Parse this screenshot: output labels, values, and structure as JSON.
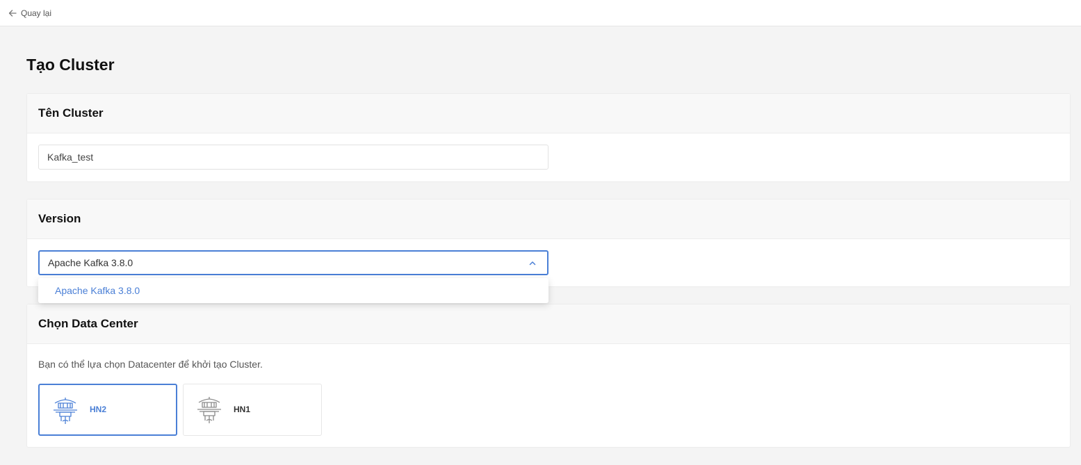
{
  "topbar": {
    "back_label": "Quay lại",
    "back_icon": "arrow-left-icon"
  },
  "page": {
    "title": "Tạo Cluster"
  },
  "cluster_name": {
    "heading": "Tên Cluster",
    "value": "Kafka_test"
  },
  "version": {
    "heading": "Version",
    "selected": "Apache Kafka 3.8.0",
    "toggle_icon": "chevron-up-icon",
    "options": [
      "Apache Kafka 3.8.0"
    ]
  },
  "datacenter": {
    "heading": "Chọn Data Center",
    "description": "Bạn có thể lựa chọn Datacenter để khởi tạo Cluster.",
    "options": [
      {
        "label": "HN2",
        "icon": "pagoda-icon",
        "selected": true
      },
      {
        "label": "HN1",
        "icon": "pagoda-icon",
        "selected": false
      }
    ]
  },
  "colors": {
    "accent": "#4a7fd6",
    "background": "#f4f4f4",
    "card_header": "#f8f8f8"
  }
}
